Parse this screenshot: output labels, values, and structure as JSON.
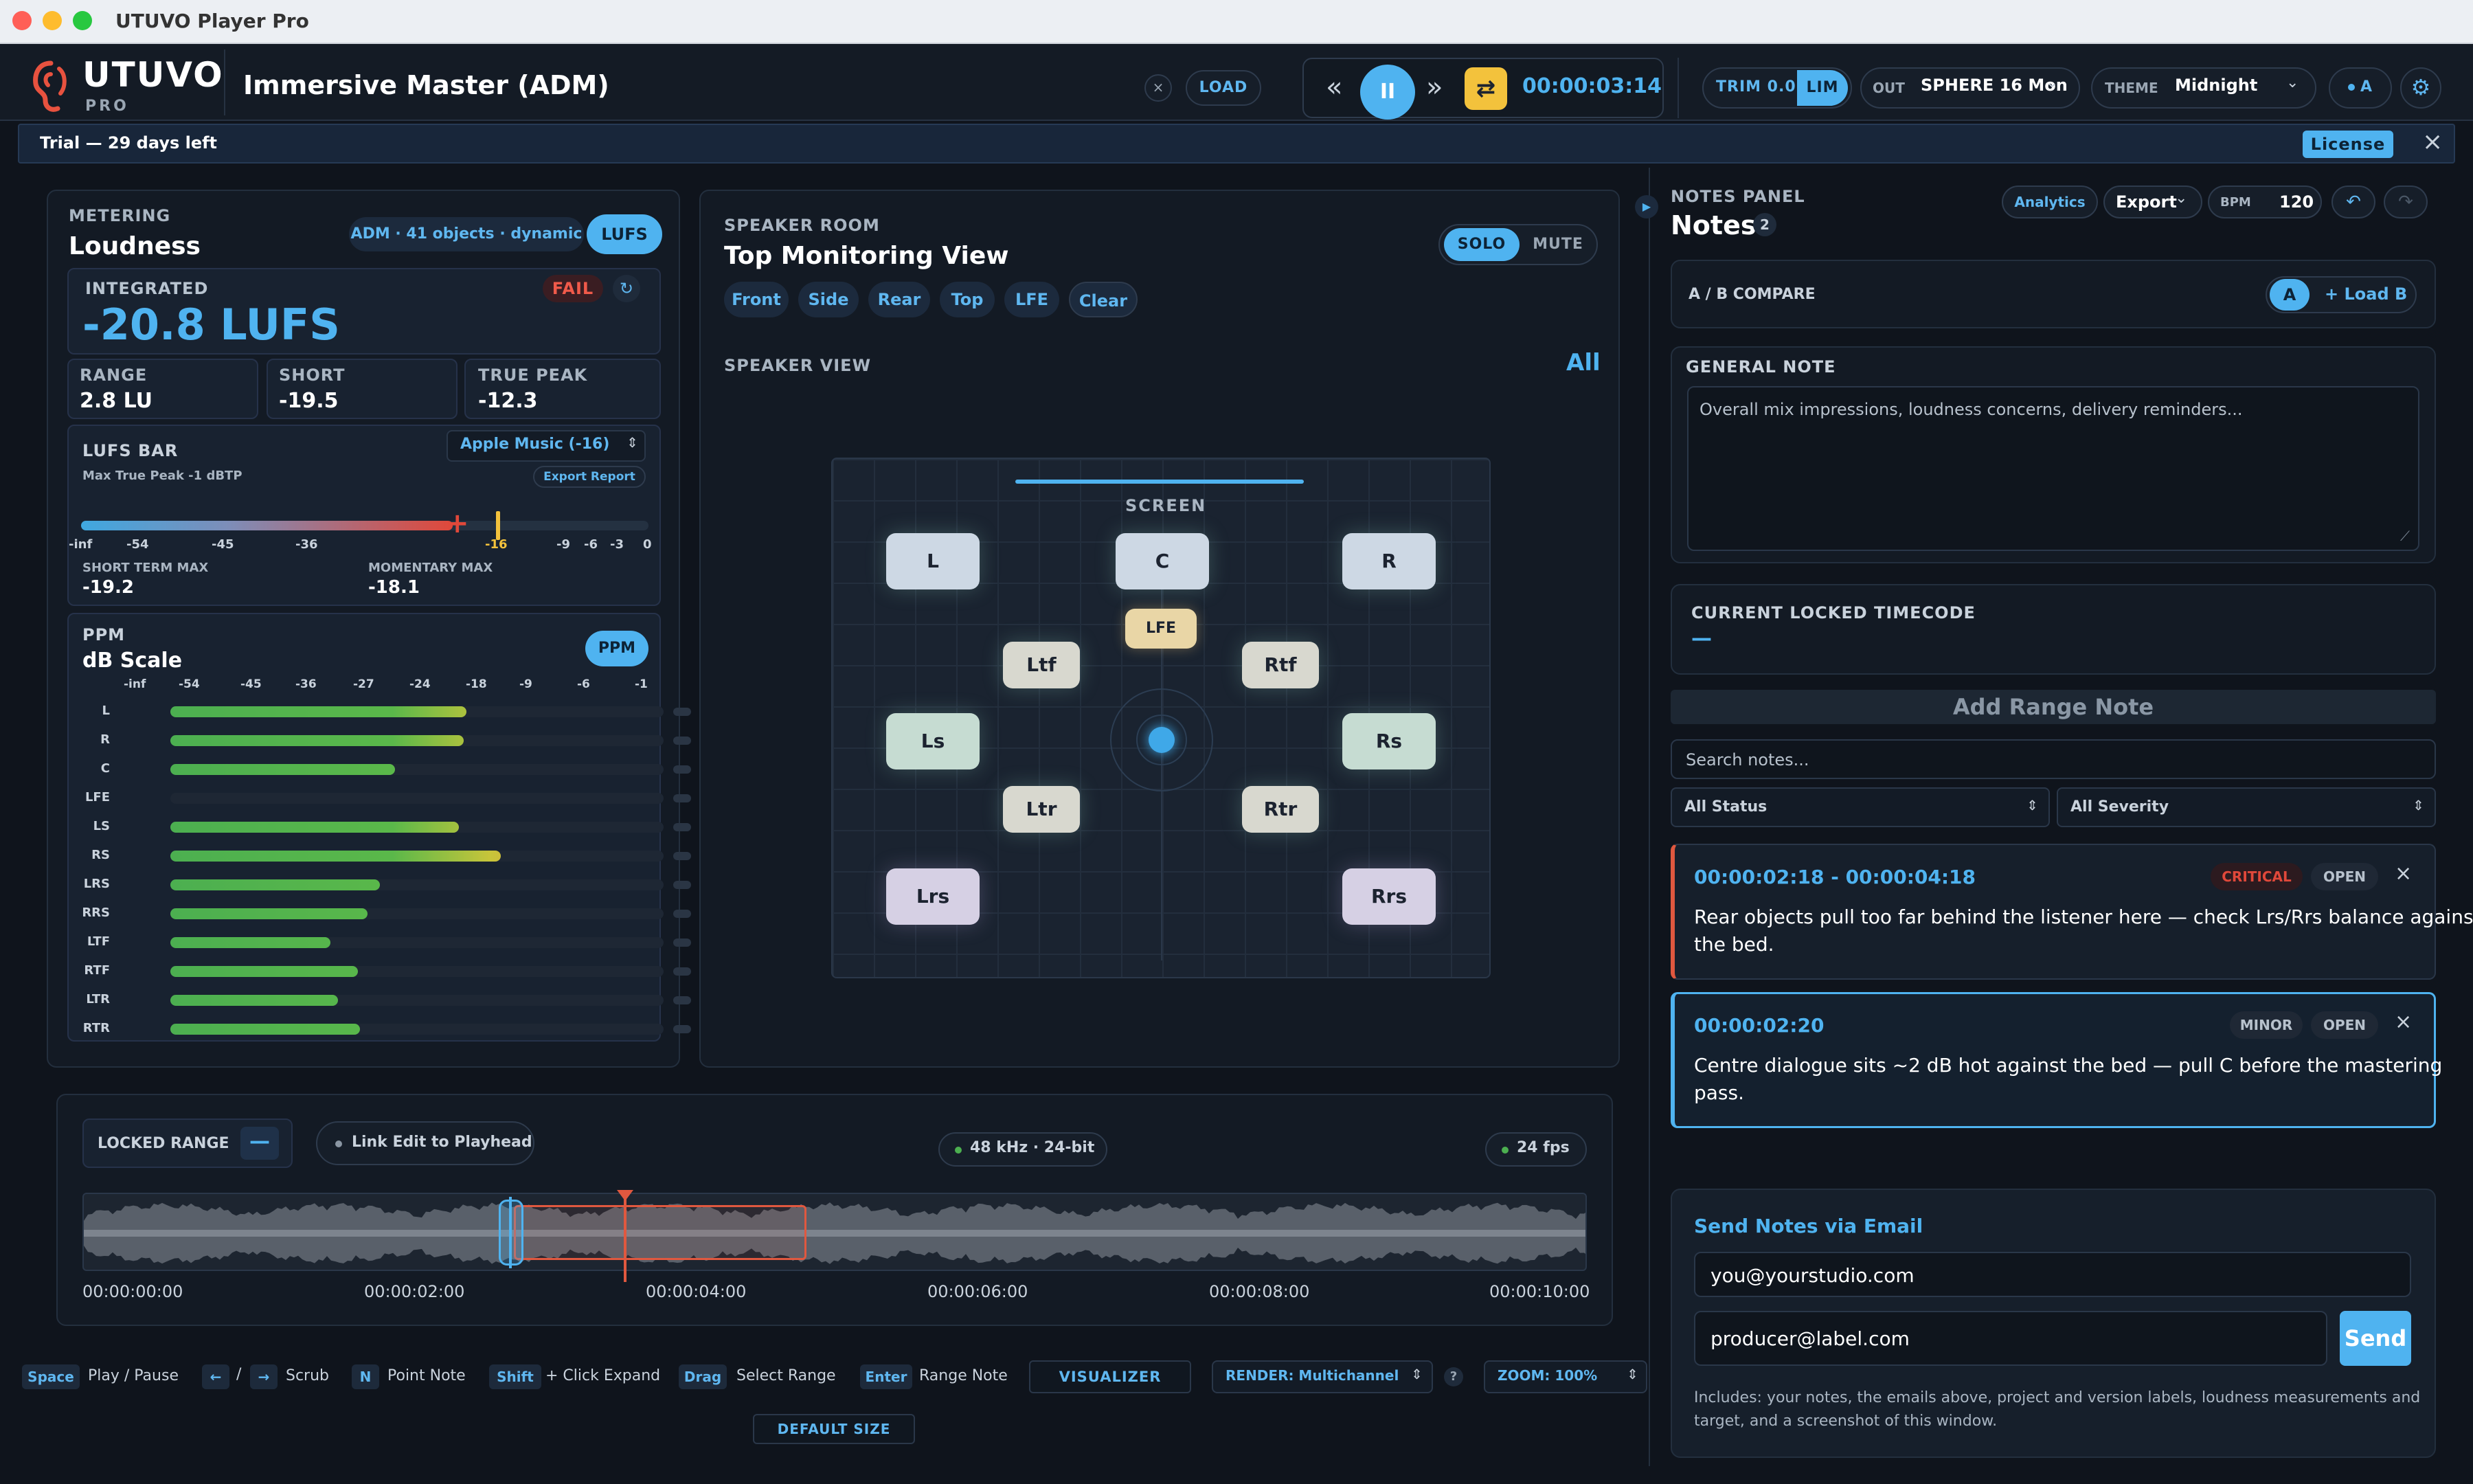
{
  "window": {
    "title": "UTUVO Player Pro"
  },
  "brand": {
    "name": "UTUVO",
    "sub": "PRO",
    "accent": "#4fb3f0",
    "logo_icon": "ear-icon"
  },
  "header": {
    "project_title": "Immersive Master (ADM)",
    "close_icon": "close-icon",
    "load_label": "LOAD",
    "transport": {
      "rewind_icon": "rewind-icon",
      "pause_icon": "pause-icon",
      "forward_icon": "fast-forward-icon",
      "loop_icon": "loop-icon",
      "timecode": "00:00:03:14"
    },
    "trim_label": "TRIM 0.0",
    "lim_label": "LIM",
    "out_label": "OUT",
    "out_value": "SPHERE 16 Mon",
    "theme_label": "THEME",
    "theme_value": "Midnight",
    "ab_label": "A",
    "settings_icon": "gear-icon"
  },
  "trial": {
    "text": "Trial — 29 days left",
    "license_label": "License",
    "close_icon": "close-icon"
  },
  "metering": {
    "section": "METERING",
    "title": "Loudness",
    "adm_chip": "ADM · 41 objects · dynamic",
    "lufs_button": "LUFS",
    "integrated_label": "INTEGRATED",
    "fail_label": "FAIL",
    "integrated_value": "-20.8 LUFS",
    "range_label": "RANGE",
    "range_value": "2.8 LU",
    "short_label": "SHORT",
    "short_value": "-19.5",
    "truepeak_label": "TRUE PEAK",
    "truepeak_value": "-12.3",
    "lufsbar_label": "LUFS BAR",
    "lufsbar_sub": "Max True Peak -1 dBTP",
    "target_select": "Apple Music (-16)",
    "export_report": "Export Report",
    "lufsbar_ticks": [
      "-inf",
      "-54",
      "-45",
      "-36",
      "-16",
      "-9",
      "-6",
      "-3",
      "0"
    ],
    "lufsbar_fill_fraction": 0.655,
    "lufsbar_target_fraction": 0.735,
    "short_term_max_label": "SHORT TERM MAX",
    "short_term_max_value": "-19.2",
    "momentary_max_label": "MOMENTARY MAX",
    "momentary_max_value": "-18.1",
    "ppm_section": "PPM",
    "ppm_title": "dB Scale",
    "ppm_button": "PPM",
    "ppm_ticks": [
      "-inf",
      "-54",
      "-45",
      "-36",
      "-27",
      "-24",
      "-18",
      "-9",
      "-6",
      "-1"
    ],
    "channels": [
      {
        "name": "L",
        "level": 0.6
      },
      {
        "name": "R",
        "level": 0.595
      },
      {
        "name": "C",
        "level": 0.455
      },
      {
        "name": "LFE",
        "level": 0.0
      },
      {
        "name": "LS",
        "level": 0.585
      },
      {
        "name": "RS",
        "level": 0.67
      },
      {
        "name": "LRS",
        "level": 0.425
      },
      {
        "name": "RRS",
        "level": 0.4
      },
      {
        "name": "LTF",
        "level": 0.325
      },
      {
        "name": "RTF",
        "level": 0.38
      },
      {
        "name": "LTR",
        "level": 0.34
      },
      {
        "name": "RTR",
        "level": 0.385
      }
    ]
  },
  "speaker": {
    "section": "SPEAKER ROOM",
    "title": "Top Monitoring View",
    "solo": "SOLO",
    "mute": "MUTE",
    "views": [
      "Front",
      "Side",
      "Rear",
      "Top",
      "LFE",
      "Clear"
    ],
    "speaker_view_label": "SPEAKER VIEW",
    "all_label": "All",
    "screen_label": "SCREEN",
    "speakers": [
      "L",
      "C",
      "R",
      "LFE",
      "Ltf",
      "Rtf",
      "Ls",
      "Rs",
      "Ltr",
      "Rtr",
      "Lrs",
      "Rrs"
    ]
  },
  "timeline": {
    "locked_range": "LOCKED RANGE",
    "minus_icon": "minus-icon",
    "link_edit": "Link Edit to Playhead",
    "sample_rate": "48 kHz · 24-bit",
    "fps": "24 fps",
    "times": [
      "00:00:00:00",
      "00:00:02:00",
      "00:00:04:00",
      "00:00:06:00",
      "00:00:08:00",
      "00:00:10:00"
    ]
  },
  "shortcuts": [
    {
      "key": "Space",
      "label": "Play / Pause"
    },
    {
      "key": "←",
      "label": ""
    },
    {
      "key": "→",
      "label": "Scrub"
    },
    {
      "key": "N",
      "label": "Point Note"
    },
    {
      "key": "Shift",
      "label": "+ Click Expand"
    },
    {
      "key": "Drag",
      "label": "Select Range"
    },
    {
      "key": "Enter",
      "label": "Range Note"
    }
  ],
  "footer": {
    "visualizer": "VISUALIZER",
    "render": "RENDER: Multichannel",
    "help": "?",
    "zoom": "ZOOM: 100%",
    "default_size": "DEFAULT SIZE",
    "slash": "/"
  },
  "notes": {
    "section": "NOTES PANEL",
    "title": "Notes",
    "count": "2",
    "analytics": "Analytics",
    "export": "Export",
    "bpm_label": "BPM",
    "bpm_value": "120",
    "undo_icon": "undo-icon",
    "redo_icon": "redo-icon",
    "ab_compare": "A / B COMPARE",
    "a_label": "A",
    "load_b": "+ Load B",
    "general_note_label": "GENERAL NOTE",
    "general_note_placeholder": "Overall mix impressions, loudness concerns, delivery reminders...",
    "locked_tc_label": "CURRENT LOCKED TIMECODE",
    "locked_tc_value": "—",
    "add_range": "Add Range Note",
    "search_placeholder": "Search notes...",
    "status_filter": "All Status",
    "severity_filter": "All Severity",
    "items": [
      {
        "time": "00:00:02:18 - 00:00:04:18",
        "severity": "CRITICAL",
        "status": "OPEN",
        "text1": "Rear objects pull too far behind the listener here — check Lrs/Rrs balance against",
        "text2": "the bed."
      },
      {
        "time": "00:00:02:20",
        "severity": "MINOR",
        "status": "OPEN",
        "text1": "Centre dialogue sits ~2 dB hot against the bed — pull C before the mastering",
        "text2": "pass."
      }
    ],
    "email_title": "Send Notes via Email",
    "email_from": "you@yourstudio.com",
    "email_to": "producer@label.com",
    "send": "Send",
    "email_info1": "Includes: your notes, the emails above, project and version labels, loudness measurements and",
    "email_info2": "target, and a screenshot of this window."
  }
}
